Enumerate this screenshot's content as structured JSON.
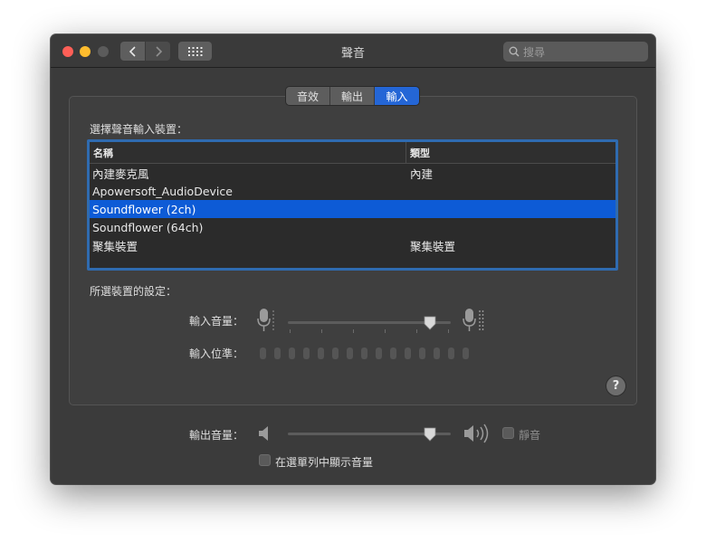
{
  "window": {
    "title": "聲音",
    "search_placeholder": "搜尋"
  },
  "tabs": [
    {
      "label": "音效",
      "active": false
    },
    {
      "label": "輸出",
      "active": false
    },
    {
      "label": "輸入",
      "active": true
    }
  ],
  "device_section": {
    "heading": "選擇聲音輸入裝置：",
    "columns": [
      "名稱",
      "類型"
    ],
    "rows": [
      {
        "name": "內建麥克風",
        "type": "內建",
        "selected": false
      },
      {
        "name": "Apowersoft_AudioDevice",
        "type": "",
        "selected": false
      },
      {
        "name": "Soundflower (2ch)",
        "type": "",
        "selected": true
      },
      {
        "name": "Soundflower (64ch)",
        "type": "",
        "selected": false
      },
      {
        "name": "聚集裝置",
        "type": "聚集裝置",
        "selected": false
      }
    ]
  },
  "settings": {
    "heading": "所選裝置的設定：",
    "input_volume_label": "輸入音量：",
    "input_volume_value": 0.87,
    "input_level_label": "輸入位準："
  },
  "output": {
    "volume_label": "輸出音量：",
    "volume_value": 0.87,
    "mute_label": "靜音",
    "menu_bar_label": "在選單列中顯示音量"
  },
  "icons": {
    "close": "close-icon",
    "minimize": "minimize-icon",
    "zoom": "zoom-icon",
    "back": "chevron-left-icon",
    "forward": "chevron-right-icon",
    "grid": "grid-icon",
    "search": "search-icon",
    "mic_low": "microphone-low-icon",
    "mic_high": "microphone-high-icon",
    "speaker_low": "speaker-low-icon",
    "speaker_high": "speaker-high-icon",
    "help": "help-icon"
  },
  "colors": {
    "accent": "#2466d6",
    "selection": "#0d5bd6",
    "window_bg": "#3b3b3b"
  }
}
